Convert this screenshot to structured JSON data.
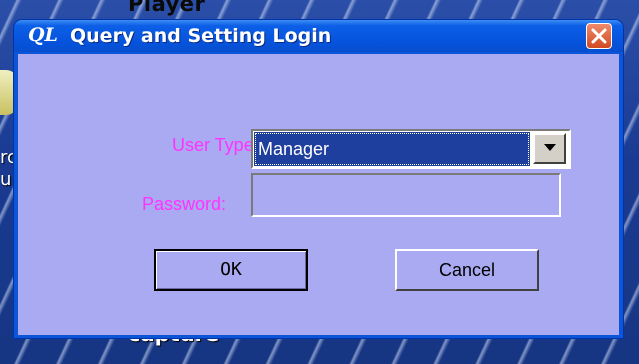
{
  "desktop": {
    "top_label": "Player",
    "bottom_label": "capture",
    "left_fragment_lines": [
      "rc",
      "u"
    ]
  },
  "window": {
    "app_icon_text": "QL",
    "title": "Query and Setting Login",
    "title_color": "#0755df",
    "client_bg": "#aaaaf2",
    "label_color": "#ff33ff"
  },
  "form": {
    "user_type_label": "User Type:",
    "user_type_value": "Manager",
    "password_label": "Password:",
    "password_value": ""
  },
  "buttons": {
    "ok": "OK",
    "cancel": "Cancel"
  },
  "icons": {
    "close": "close-x-icon",
    "dropdown": "triangle-down-icon"
  }
}
